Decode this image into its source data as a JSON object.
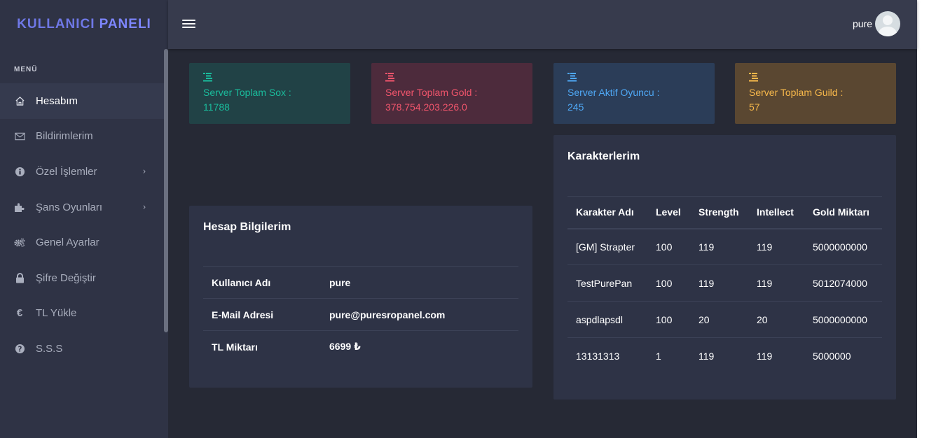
{
  "brand": {
    "part1": "KULLANICI",
    "part2": "PANELI"
  },
  "sidebar": {
    "menu_title": "MENÜ",
    "items": [
      {
        "label": "Hesabım",
        "icon": "home-icon",
        "active": true
      },
      {
        "label": "Bildirimlerim",
        "icon": "envelope-icon"
      },
      {
        "label": "Özel İşlemler",
        "icon": "info-circle-icon",
        "has_submenu": true
      },
      {
        "label": "Şans Oyunları",
        "icon": "puzzle-icon",
        "has_submenu": true
      },
      {
        "label": "Genel Ayarlar",
        "icon": "gears-icon"
      },
      {
        "label": "Şifre Değiştir",
        "icon": "lock-icon"
      },
      {
        "label": "TL Yükle",
        "icon": "euro-icon"
      },
      {
        "label": "S.S.S",
        "icon": "question-circle-icon"
      }
    ]
  },
  "topbar": {
    "username": "pure"
  },
  "stats": [
    {
      "label": "Server Toplam Sox :",
      "value": "11788",
      "color": "#1abc9c",
      "bg": "#214246"
    },
    {
      "label": "Server Toplam Gold :",
      "value": "378.754.203.226.0",
      "color": "#f1556c",
      "bg": "#4d2b3c"
    },
    {
      "label": "Server Aktif Oyuncu :",
      "value": "245",
      "color": "#4fa8f5",
      "bg": "#2b3d58"
    },
    {
      "label": "Server Toplam Guild :",
      "value": "57",
      "color": "#f7b84b",
      "bg": "#5a4731"
    }
  ],
  "account": {
    "title": "Hesap Bilgilerim",
    "rows": [
      {
        "label": "Kullanıcı Adı",
        "value": "pure"
      },
      {
        "label": "E-Mail Adresi",
        "value": "pure@puresropanel.com"
      },
      {
        "label": "TL Miktarı",
        "value": "6699 ₺"
      }
    ]
  },
  "characters": {
    "title": "Karakterlerim",
    "headers": [
      "Karakter Adı",
      "Level",
      "Strength",
      "Intellect",
      "Gold Miktarı"
    ],
    "rows": [
      [
        "[GM] Strapter",
        "100",
        "119",
        "119",
        "5000000000"
      ],
      [
        "TestPurePan",
        "100",
        "119",
        "119",
        "5012074000"
      ],
      [
        "aspdlapsdl",
        "100",
        "20",
        "20",
        "5000000000"
      ],
      [
        "13131313",
        "1",
        "119",
        "119",
        "5000000"
      ]
    ]
  }
}
